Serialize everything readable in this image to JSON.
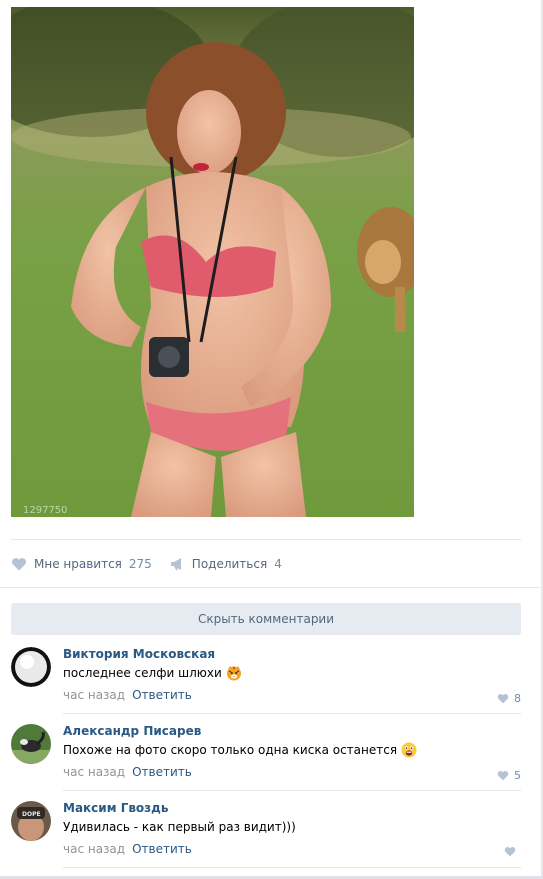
{
  "post": {
    "image_watermark": "1297750"
  },
  "actions": {
    "like_label": "Мне нравится",
    "like_count": "275",
    "like_icon": "heart-icon",
    "share_label": "Поделиться",
    "share_count": "4",
    "share_icon": "megaphone-icon"
  },
  "comments_panel": {
    "hide_label": "Скрыть комментарии"
  },
  "comments": [
    {
      "author": "Виктория Московская",
      "text": "последнее селфи шлюхи",
      "emoji": "tiger-face-emoji",
      "time": "час назад",
      "reply_label": "Ответить",
      "likes": "8"
    },
    {
      "author": "Александр Писарев",
      "text": "Похоже на фото скоро только одна киска останется",
      "emoji": "grimacing-face-emoji",
      "time": "час назад",
      "reply_label": "Ответить",
      "likes": "5"
    },
    {
      "author": "Максим Гвоздь",
      "text": "Удивилась - как первый раз видит)))",
      "emoji": "",
      "time": "час назад",
      "reply_label": "Ответить",
      "likes": ""
    }
  ],
  "colors": {
    "link": "#2a5885",
    "muted": "#939393",
    "action_text": "#55677d",
    "icon": "#b4c3d3",
    "hide_bg": "#e5ebf1"
  }
}
